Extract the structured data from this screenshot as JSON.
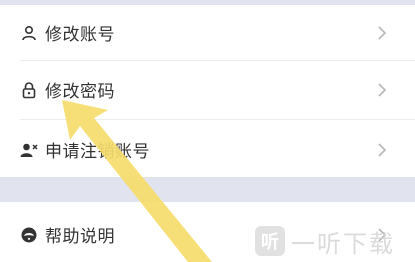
{
  "settings": {
    "items": [
      {
        "label": "修改账号",
        "icon": "person-icon"
      },
      {
        "label": "修改密码",
        "icon": "lock-icon"
      },
      {
        "label": "申请注销账号",
        "icon": "remove-user-icon"
      },
      {
        "label": "帮助说明",
        "icon": "help-bubble-icon"
      }
    ]
  },
  "watermark": {
    "logo_char": "听",
    "text": "一听下载"
  },
  "colors": {
    "section_gap": "#e1e4ee",
    "text": "#333333",
    "chevron": "#b5b5b5",
    "arrow": "#f5dc6a"
  }
}
